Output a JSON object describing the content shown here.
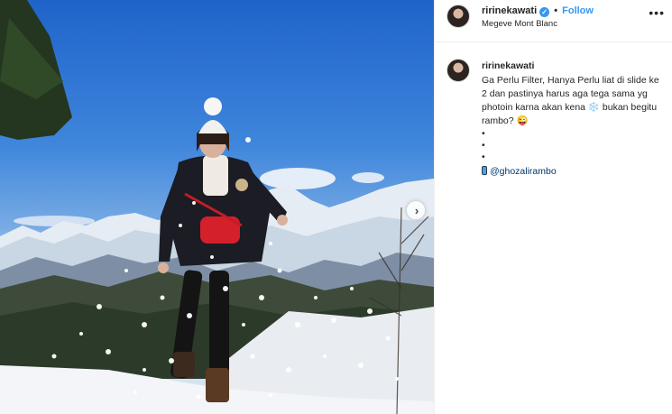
{
  "post": {
    "username": "ririnekawati",
    "follow_label": "Follow",
    "separator": "•",
    "location": "Megeve Mont Blanc",
    "more_label": "•••"
  },
  "caption": {
    "username": "ririnekawati",
    "text": "Ga Perlu Filter, Hanya Perlu liat di slide ke 2 dan pastinya harus aga tega sama yg photoin karna akan kena ❄️ bukan begitu rambo? 😜",
    "dots": [
      "•",
      "•",
      "•"
    ],
    "mention": "@ghozalirambo"
  },
  "icons": {
    "verified": "verified-badge-icon",
    "next": "chevron-right-icon",
    "more": "more-options-icon",
    "phone": "mobile-phone-icon"
  },
  "colors": {
    "accent": "#3897f0",
    "mention": "#00376b",
    "text": "#262626"
  }
}
